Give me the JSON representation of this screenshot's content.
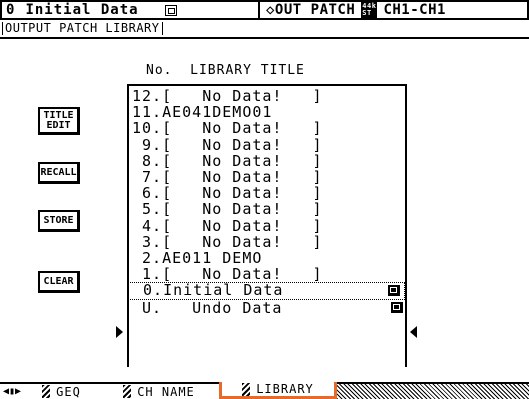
{
  "header": {
    "memory_number": "0",
    "memory_title": "Initial Data",
    "screen_name": "◇OUT PATCH",
    "fs_top": "44k",
    "fs_bottom": "ST",
    "channel": "CH1-CH1"
  },
  "page_title": "OUTPUT PATCH LIBRARY",
  "column_header": "No.  LIBRARY TITLE",
  "buttons": {
    "title_edit_line1": "TITLE",
    "title_edit_line2": "EDIT",
    "recall": "RECALL",
    "store": "STORE",
    "clear": "CLEAR"
  },
  "library": [
    {
      "text": "12.[   No Data!   ]",
      "locked": false,
      "selected": false
    },
    {
      "text": "11.AE041DEMO01",
      "locked": false,
      "selected": false
    },
    {
      "text": "10.[   No Data!   ]",
      "locked": false,
      "selected": false
    },
    {
      "text": " 9.[   No Data!   ]",
      "locked": false,
      "selected": false
    },
    {
      "text": " 8.[   No Data!   ]",
      "locked": false,
      "selected": false
    },
    {
      "text": " 7.[   No Data!   ]",
      "locked": false,
      "selected": false
    },
    {
      "text": " 6.[   No Data!   ]",
      "locked": false,
      "selected": false
    },
    {
      "text": " 5.[   No Data!   ]",
      "locked": false,
      "selected": false
    },
    {
      "text": " 4.[   No Data!   ]",
      "locked": false,
      "selected": false
    },
    {
      "text": " 3.[   No Data!   ]",
      "locked": false,
      "selected": false
    },
    {
      "text": " 2.AE011 DEMO",
      "locked": false,
      "selected": false
    },
    {
      "text": " 1.[   No Data!   ]",
      "locked": false,
      "selected": false
    },
    {
      "text": " 0.Initial Data",
      "locked": true,
      "selected": true
    },
    {
      "text": " U.   Undo Data",
      "locked": true,
      "selected": false
    }
  ],
  "tabs": [
    {
      "label": "GEQ"
    },
    {
      "label": "CH NAME"
    },
    {
      "label": "LIBRARY",
      "active": true
    }
  ],
  "colors": {
    "active_tab_outline": "#e86a2a"
  }
}
